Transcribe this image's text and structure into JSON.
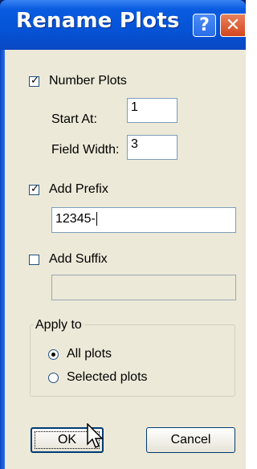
{
  "dialog": {
    "title": "Rename Plots",
    "help_label": "?",
    "close_label": "✕"
  },
  "number_plots": {
    "label": "Number Plots",
    "checked": true,
    "start_at_label": "Start At:",
    "start_at_value": "1",
    "field_width_label": "Field Width:",
    "field_width_value": "3"
  },
  "add_prefix": {
    "label": "Add Prefix",
    "checked": true,
    "value": "12345-"
  },
  "add_suffix": {
    "label": "Add Suffix",
    "checked": false,
    "value": ""
  },
  "apply_to": {
    "legend": "Apply to",
    "options": [
      {
        "label": "All plots",
        "selected": true
      },
      {
        "label": "Selected plots",
        "selected": false
      }
    ]
  },
  "buttons": {
    "ok_label": "OK",
    "cancel_label": "Cancel"
  },
  "colors": {
    "titlebar": "#0553d6",
    "dialog_bg": "#ece9d8",
    "close_button": "#d4471e"
  }
}
